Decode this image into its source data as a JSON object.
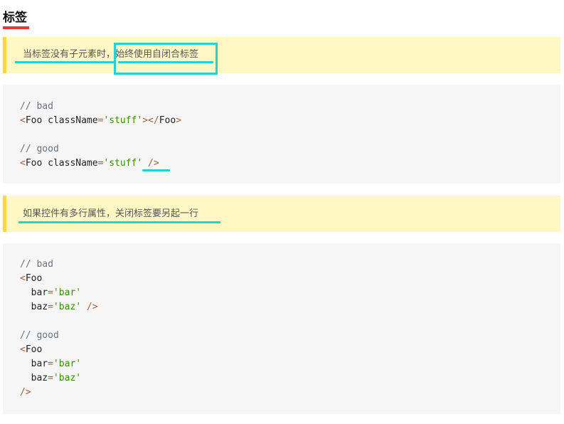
{
  "section": {
    "title": "标签"
  },
  "callouts": [
    {
      "part1": "当标签没有子元素时，",
      "part2": "始终使用自闭合标签"
    },
    {
      "text": "如果控件有多行属性，关闭标签要另起一行"
    }
  ],
  "code1": {
    "comment_bad": "// bad",
    "bad": {
      "open": "<",
      "tag": "Foo",
      "attr": " className",
      "eq": "=",
      "str": "'stuff'",
      "close": "></",
      "tag2": "Foo",
      "end": ">"
    },
    "comment_good": "// good",
    "good": {
      "open": "<",
      "tag": "Foo",
      "attr": " className",
      "eq": "=",
      "str": "'stuff'",
      "selfclose": " />"
    }
  },
  "code2": {
    "comment_bad": "// bad",
    "bad_open": "<",
    "bad_tag": "Foo",
    "bad_attr1": "  bar",
    "bad_eq1": "=",
    "bad_str1": "'bar'",
    "bad_attr2": "  baz",
    "bad_eq2": "=",
    "bad_str2": "'baz'",
    "bad_selfclose": " />",
    "comment_good": "// good",
    "good_open": "<",
    "good_tag": "Foo",
    "good_attr1": "  bar",
    "good_eq1": "=",
    "good_str1": "'bar'",
    "good_attr2": "  baz",
    "good_eq2": "=",
    "good_str2": "'baz'",
    "good_selfclose": "/>"
  },
  "colors": {
    "highlight": "#22d3cf",
    "title_underline": "#e53935",
    "callout_bg": "#fff8c5",
    "callout_border": "#ffd54f",
    "code_bg": "#f6f6f6",
    "string": "#3a8a0b",
    "comment": "#6a737d"
  }
}
